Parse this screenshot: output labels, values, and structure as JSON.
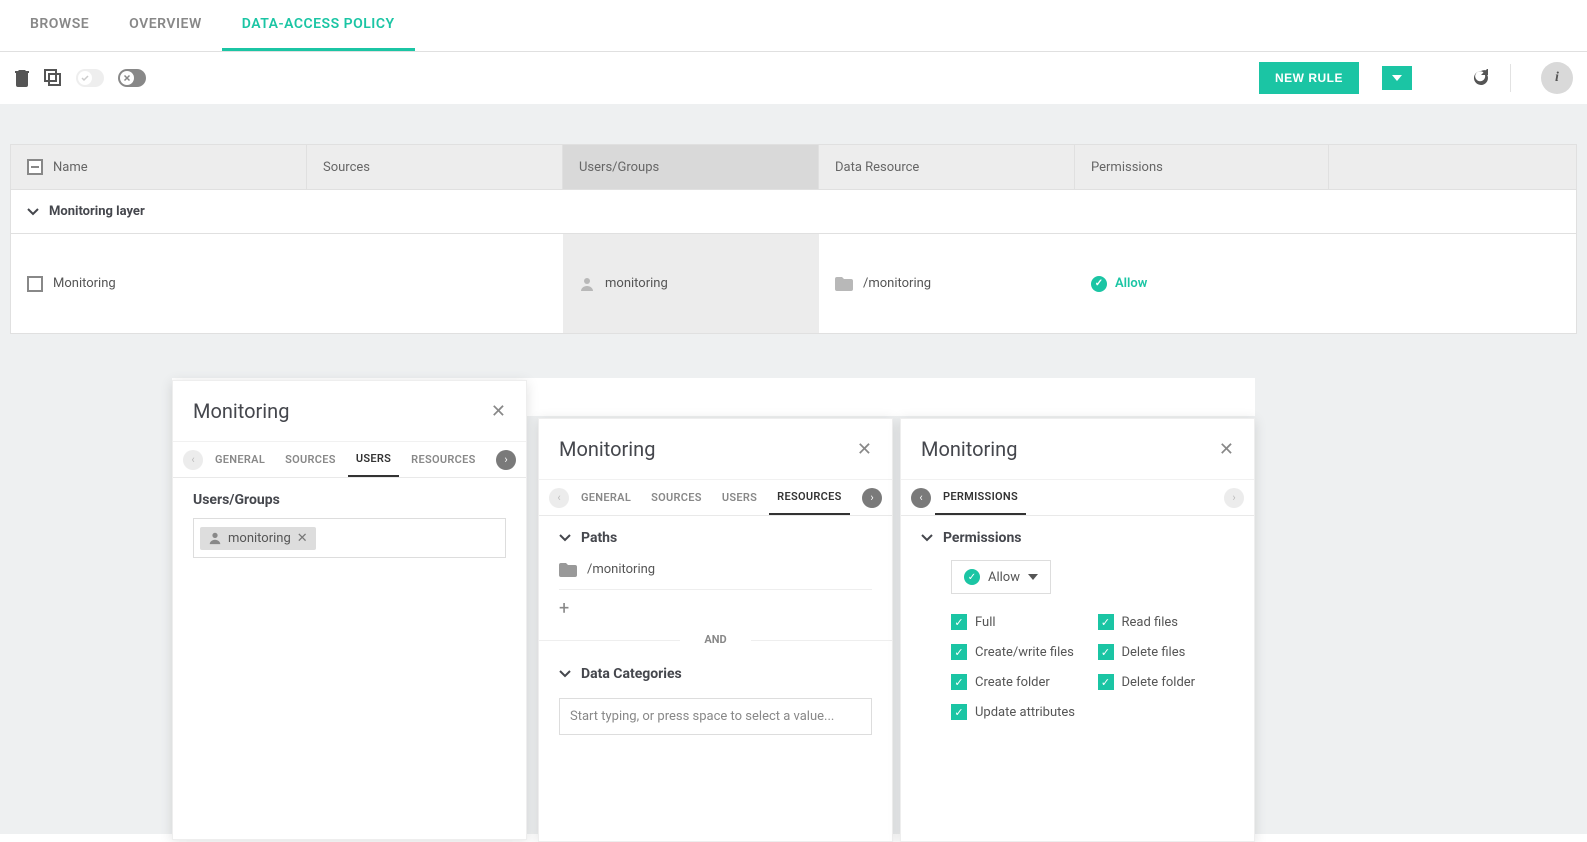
{
  "tabs": {
    "browse": "BROWSE",
    "overview": "OVERVIEW",
    "policy": "DATA-ACCESS POLICY"
  },
  "toolbar": {
    "new_rule": "NEW RULE"
  },
  "grid": {
    "headers": {
      "name": "Name",
      "sources": "Sources",
      "users": "Users/Groups",
      "resource": "Data Resource",
      "permissions": "Permissions"
    },
    "group": "Monitoring layer",
    "row": {
      "name": "Monitoring",
      "user": "monitoring",
      "resource": "/monitoring",
      "permission": "Allow"
    }
  },
  "panel1": {
    "title": "Monitoring",
    "tabs": {
      "general": "GENERAL",
      "sources": "SOURCES",
      "users": "USERS",
      "resources": "RESOURCES"
    },
    "section": "Users/Groups",
    "chip": "monitoring"
  },
  "panel2": {
    "title": "Monitoring",
    "tabs": {
      "general": "GENERAL",
      "sources": "SOURCES",
      "users": "USERS",
      "resources": "RESOURCES"
    },
    "paths_label": "Paths",
    "path": "/monitoring",
    "and": "AND",
    "datacat_label": "Data Categories",
    "datacat_placeholder": "Start typing, or press space to select a value..."
  },
  "panel3": {
    "title": "Monitoring",
    "tabs": {
      "permissions": "PERMISSIONS"
    },
    "section": "Permissions",
    "allow": "Allow",
    "perms": {
      "full": "Full",
      "read": "Read files",
      "create_write": "Create/write files",
      "delete_files": "Delete files",
      "create_folder": "Create folder",
      "delete_folder": "Delete folder",
      "update_attrs": "Update attributes"
    }
  }
}
